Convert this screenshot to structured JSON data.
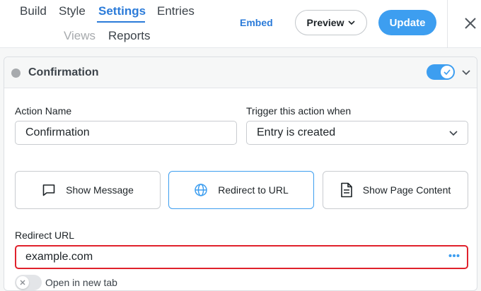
{
  "header": {
    "tabs": [
      {
        "label": "Build"
      },
      {
        "label": "Style"
      },
      {
        "label": "Settings",
        "active": true
      },
      {
        "label": "Entries"
      },
      {
        "label": "Views",
        "muted": true
      },
      {
        "label": "Reports"
      }
    ],
    "embed_label": "Embed",
    "preview_label": "Preview",
    "update_label": "Update"
  },
  "action": {
    "title": "Confirmation",
    "enabled": true,
    "action_name_label": "Action Name",
    "action_name_value": "Confirmation",
    "trigger_label": "Trigger this action when",
    "trigger_value": "Entry is created",
    "choices": [
      {
        "label": "Show Message",
        "icon": "message-icon"
      },
      {
        "label": "Redirect to URL",
        "icon": "globe-icon",
        "selected": true
      },
      {
        "label": "Show Page Content",
        "icon": "document-icon"
      }
    ],
    "redirect_url_label": "Redirect URL",
    "redirect_url_value": "example.com",
    "open_new_tab_label": "Open in new tab",
    "open_new_tab": false
  },
  "colors": {
    "accent": "#3d9ef0",
    "active_tab": "#2b7bd9",
    "error_border": "#e0212c"
  }
}
